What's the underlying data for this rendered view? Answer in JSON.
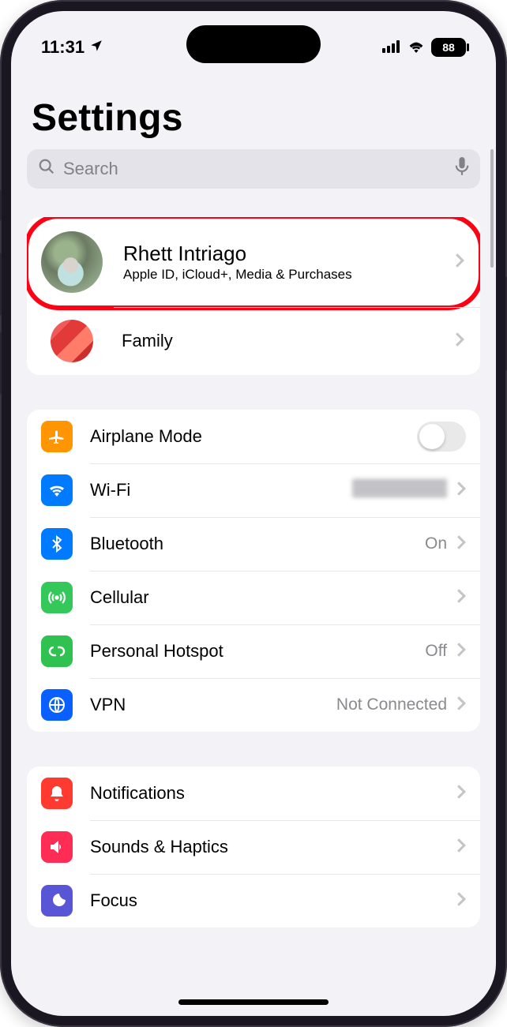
{
  "status": {
    "time": "11:31",
    "battery": "88"
  },
  "page": {
    "title": "Settings"
  },
  "search": {
    "placeholder": "Search"
  },
  "profile": {
    "name": "Rhett Intriago",
    "subtitle": "Apple ID, iCloud+, Media & Purchases",
    "family_label": "Family"
  },
  "group1": {
    "airplane": "Airplane Mode",
    "wifi": "Wi-Fi",
    "bluetooth": "Bluetooth",
    "bluetooth_value": "On",
    "cellular": "Cellular",
    "hotspot": "Personal Hotspot",
    "hotspot_value": "Off",
    "vpn": "VPN",
    "vpn_value": "Not Connected"
  },
  "group2": {
    "notifications": "Notifications",
    "sounds": "Sounds & Haptics",
    "focus": "Focus"
  }
}
